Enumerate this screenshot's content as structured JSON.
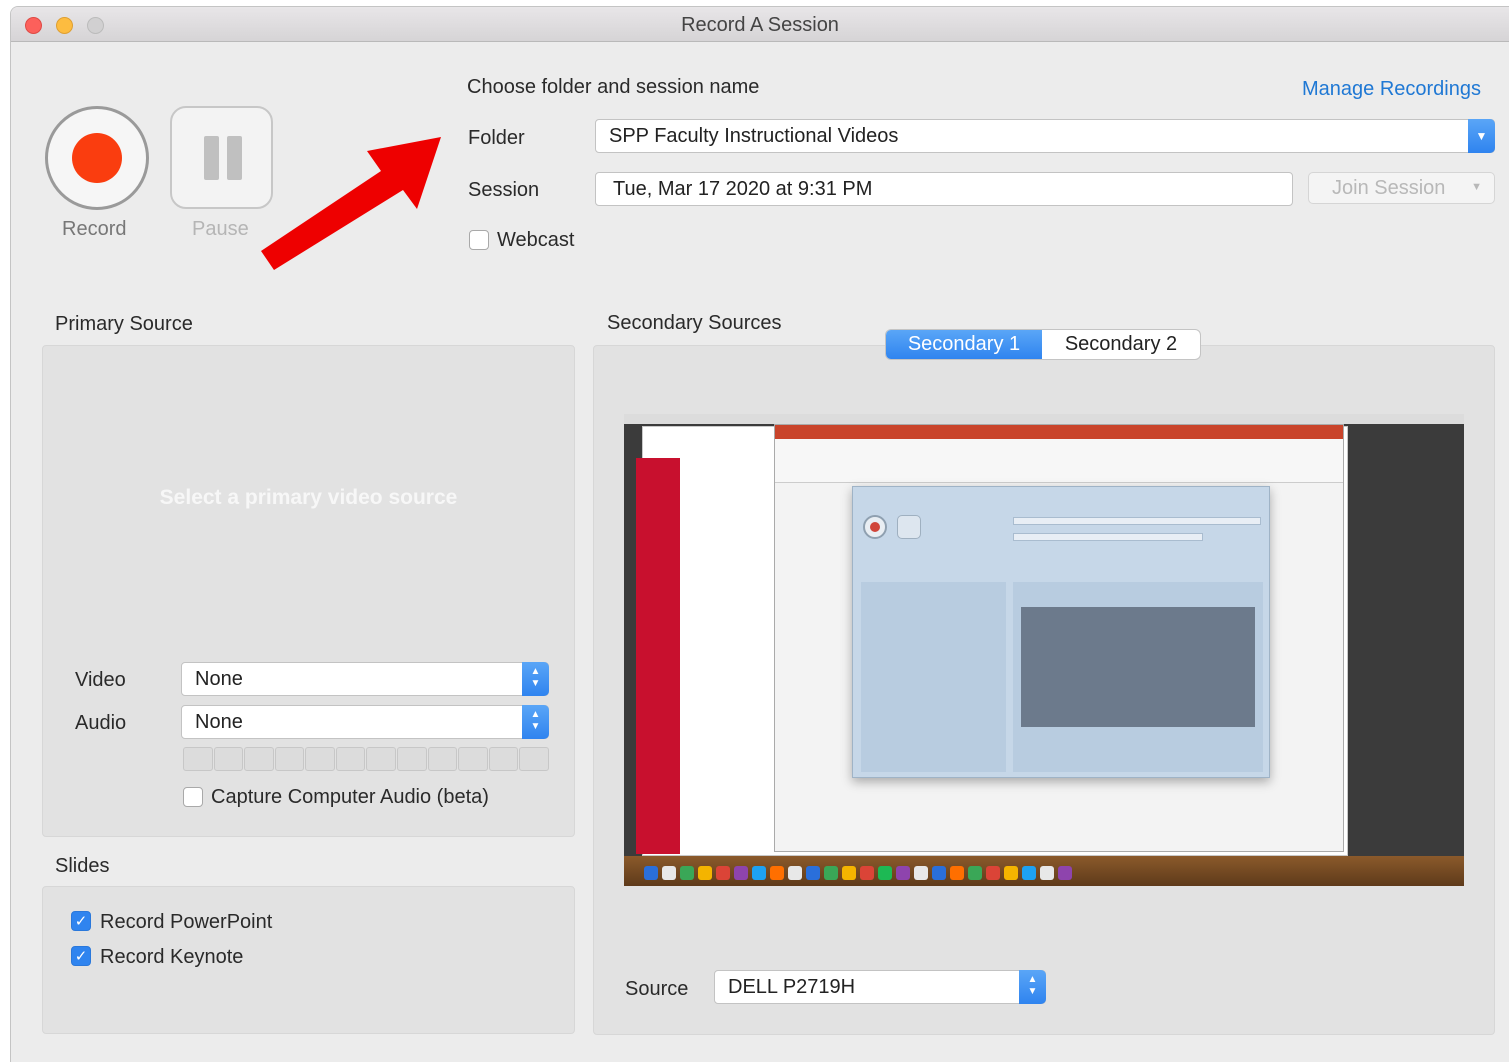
{
  "window": {
    "title": "Record A Session"
  },
  "controls": {
    "record_label": "Record",
    "pause_label": "Pause"
  },
  "session": {
    "heading": "Choose folder and session name",
    "manage_link": "Manage Recordings",
    "folder_label": "Folder",
    "folder_value": "SPP Faculty Instructional Videos",
    "session_label": "Session",
    "session_value": "Tue, Mar 17 2020 at 9:31 PM",
    "join_button": "Join Session",
    "webcast_label": "Webcast",
    "webcast_checked": false
  },
  "primary": {
    "heading": "Primary Source",
    "placeholder": "Select a primary video source",
    "video_label": "Video",
    "video_value": "None",
    "audio_label": "Audio",
    "audio_value": "None",
    "capture_audio_label": "Capture Computer Audio (beta)",
    "capture_audio_checked": false
  },
  "slides": {
    "heading": "Slides",
    "items": [
      {
        "label": "Record PowerPoint",
        "checked": true
      },
      {
        "label": "Record Keynote",
        "checked": true
      }
    ]
  },
  "secondary": {
    "heading": "Secondary Sources",
    "tabs": [
      {
        "label": "Secondary 1",
        "active": true
      },
      {
        "label": "Secondary 2",
        "active": false
      }
    ],
    "source_label": "Source",
    "source_value": "DELL P2719H"
  },
  "annotation": {
    "arrow_color": "#ee0000"
  },
  "colors": {
    "accent": "#2f84ef",
    "record": "#fa3d0f",
    "link": "#1f78d4"
  }
}
